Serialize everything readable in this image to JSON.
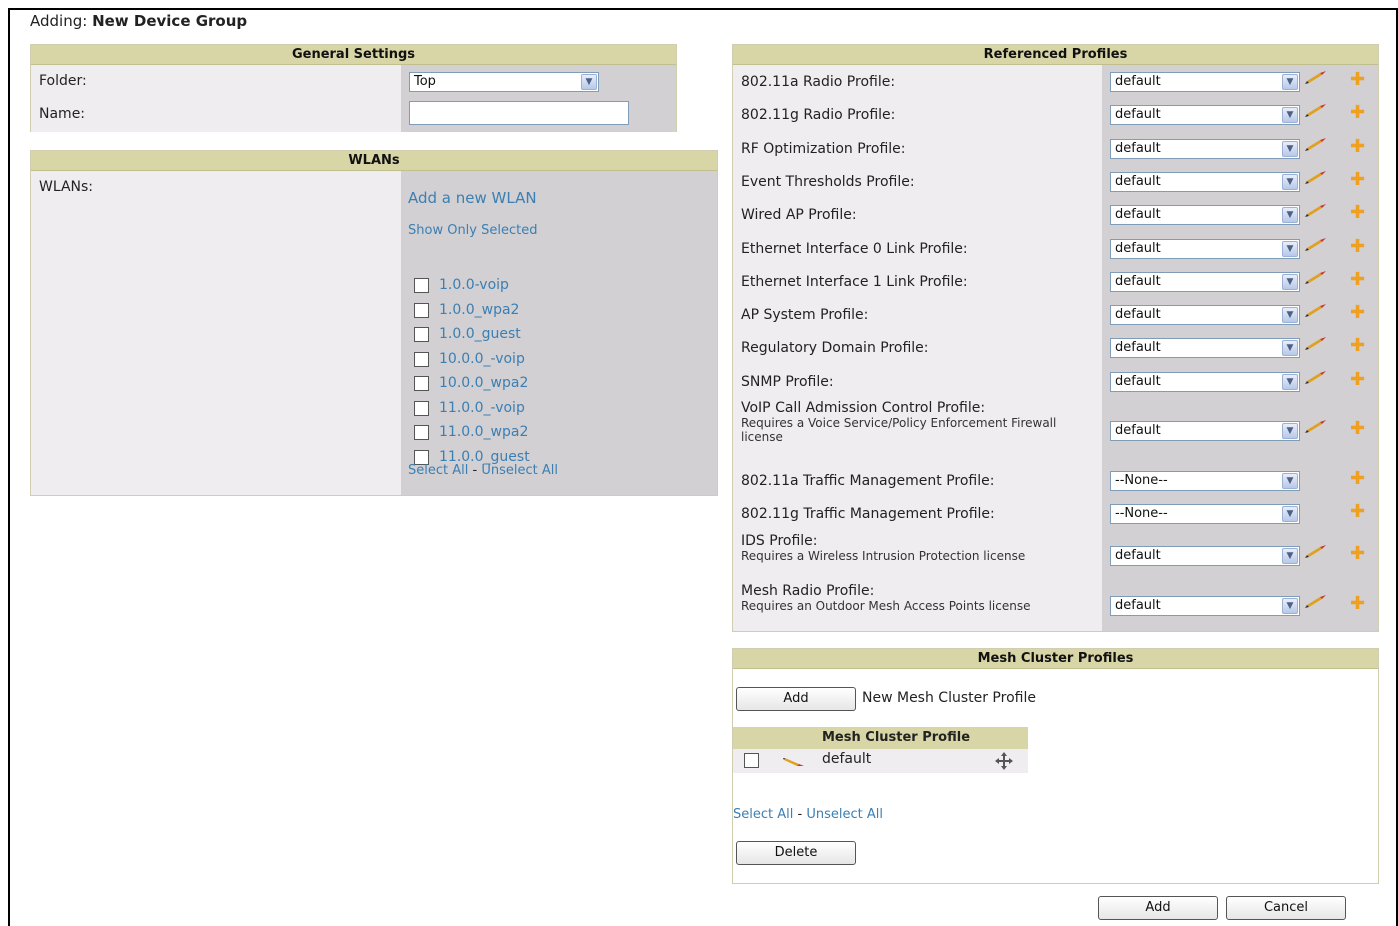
{
  "page": {
    "prefix": "Adding:",
    "title": "New Device Group"
  },
  "general": {
    "header": "General Settings",
    "folder_label": "Folder:",
    "folder_value": "Top",
    "name_label": "Name:",
    "name_value": ""
  },
  "wlans": {
    "header": "WLANs",
    "label": "WLANs:",
    "add_link": "Add a new WLAN",
    "show_selected_link": "Show Only Selected",
    "items": [
      "1.0.0-voip",
      "1.0.0_wpa2",
      "1.0.0_guest",
      "10.0.0_-voip",
      "10.0.0_wpa2",
      "11.0.0_-voip",
      "11.0.0_wpa2",
      "11.0.0_guest"
    ],
    "select_all": "Select All",
    "separator": "-",
    "unselect_all": "Unselect All"
  },
  "referenced": {
    "header": "Referenced Profiles",
    "rows": [
      {
        "label": "802.11a Radio Profile:",
        "value": "default",
        "edit": true
      },
      {
        "label": "802.11g Radio Profile:",
        "value": "default",
        "edit": true
      },
      {
        "label": "RF Optimization Profile:",
        "value": "default",
        "edit": true
      },
      {
        "label": "Event Thresholds Profile:",
        "value": "default",
        "edit": true
      },
      {
        "label": "Wired AP Profile:",
        "value": "default",
        "edit": true
      },
      {
        "label": "Ethernet Interface 0 Link Profile:",
        "value": "default",
        "edit": true
      },
      {
        "label": "Ethernet Interface 1 Link Profile:",
        "value": "default",
        "edit": true
      },
      {
        "label": "AP System Profile:",
        "value": "default",
        "edit": true
      },
      {
        "label": "Regulatory Domain Profile:",
        "value": "default",
        "edit": true
      },
      {
        "label": "SNMP Profile:",
        "value": "default",
        "edit": true
      },
      {
        "label": "VoIP Call Admission Control Profile:",
        "note": "Requires a Voice Service/Policy Enforcement Firewall license",
        "value": "default",
        "edit": true
      },
      {
        "label": "802.11a Traffic Management Profile:",
        "value": "--None--",
        "edit": false
      },
      {
        "label": "802.11g Traffic Management Profile:",
        "value": "--None--",
        "edit": false
      },
      {
        "label": "IDS Profile:",
        "note": "Requires a Wireless Intrusion Protection license",
        "value": "default",
        "edit": true
      },
      {
        "label": "Mesh Radio Profile:",
        "note": "Requires an Outdoor Mesh Access Points license",
        "value": "default",
        "edit": true
      }
    ]
  },
  "mesh": {
    "header": "Mesh Cluster Profiles",
    "add_button": "Add",
    "add_caption": "New Mesh Cluster Profile",
    "table_header": "Mesh Cluster Profile",
    "rows": [
      {
        "name": "default"
      }
    ],
    "select_all": "Select All",
    "separator": "-",
    "unselect_all": "Unselect All",
    "delete_button": "Delete"
  },
  "footer": {
    "add_button": "Add",
    "cancel_button": "Cancel"
  }
}
